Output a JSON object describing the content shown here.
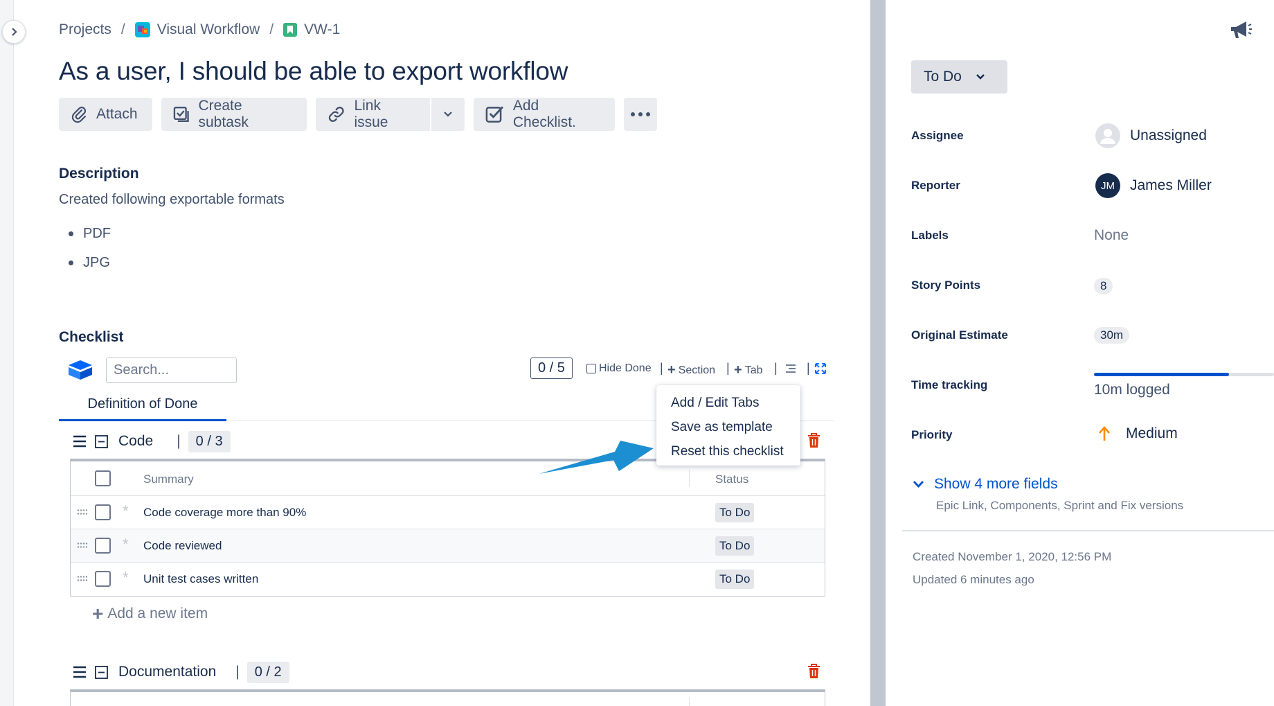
{
  "breadcrumb": {
    "projects": "Projects",
    "separator": "/",
    "project": "Visual Workflow",
    "issue_key": "VW-1"
  },
  "issue": {
    "title": "As a user, I should be able to export workflow"
  },
  "toolbar": {
    "attach": "Attach",
    "create_subtask": "Create subtask",
    "link_issue": "Link issue",
    "add_checklist": "Add Checklist."
  },
  "description": {
    "heading": "Description",
    "text": "Created following exportable formats",
    "bullets": [
      "PDF",
      "JPG"
    ]
  },
  "checklist": {
    "heading": "Checklist",
    "search_placeholder": "Search...",
    "progress": "0 / 5",
    "hide_done": "Hide Done",
    "add_section": "Section",
    "add_tab": "Tab",
    "tab": "Definition of Done",
    "menu": [
      "Add / Edit Tabs",
      "Save as template",
      "Reset this checklist"
    ],
    "sections": [
      {
        "name": "Code",
        "progress": "0 / 3",
        "columns": {
          "summary": "Summary",
          "status": "Status"
        },
        "items": [
          {
            "summary": "Code coverage more than 90%",
            "status": "To Do"
          },
          {
            "summary": "Code reviewed",
            "status": "To Do"
          },
          {
            "summary": "Unit test cases written",
            "status": "To Do"
          }
        ],
        "add_item": "Add a new item"
      },
      {
        "name": "Documentation",
        "progress": "0 / 2"
      }
    ]
  },
  "sidebar": {
    "status": "To Do",
    "fields": {
      "assignee": {
        "label": "Assignee",
        "value": "Unassigned"
      },
      "reporter": {
        "label": "Reporter",
        "value": "James Miller",
        "initials": "JM"
      },
      "labels": {
        "label": "Labels",
        "value": "None"
      },
      "story_points": {
        "label": "Story Points",
        "value": "8"
      },
      "original_estimate": {
        "label": "Original Estimate",
        "value": "30m"
      },
      "time_tracking": {
        "label": "Time tracking",
        "value": "10m logged",
        "progress": 0.75
      },
      "priority": {
        "label": "Priority",
        "value": "Medium"
      }
    },
    "more_fields": "Show 4 more fields",
    "more_fields_hint": "Epic Link, Components, Sprint and Fix versions",
    "created": "Created November 1, 2020, 12:56 PM",
    "updated": "Updated 6 minutes ago"
  },
  "colors": {
    "accent": "#0052cc",
    "danger": "#de350b",
    "arrow": "#1b8fd1",
    "priority": "#ff8b00"
  },
  "icons": [
    "chevron-right-icon",
    "project-icon",
    "story-icon",
    "paperclip-icon",
    "subtask-icon",
    "link-icon",
    "chevron-down-icon",
    "checklist-icon",
    "more-icon",
    "checklist-logo-icon",
    "list-icon",
    "expand-icon",
    "hamburger-icon",
    "collapse-icon",
    "trash-icon",
    "plus-icon",
    "megaphone-icon",
    "user-icon",
    "arrow-up-icon"
  ]
}
